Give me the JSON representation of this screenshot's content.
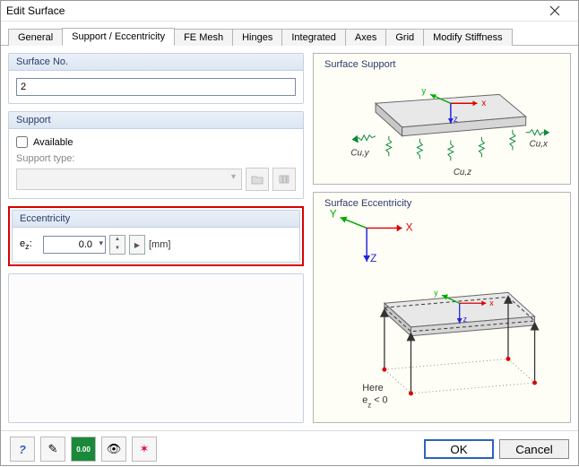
{
  "window": {
    "title": "Edit Surface"
  },
  "tabs": {
    "items": [
      {
        "label": "General"
      },
      {
        "label": "Support / Eccentricity"
      },
      {
        "label": "FE Mesh"
      },
      {
        "label": "Hinges"
      },
      {
        "label": "Integrated"
      },
      {
        "label": "Axes"
      },
      {
        "label": "Grid"
      },
      {
        "label": "Modify Stiffness"
      }
    ],
    "active_index": 1
  },
  "surface_no": {
    "title": "Surface No.",
    "value": "2"
  },
  "support": {
    "title": "Support",
    "available_label": "Available",
    "available_checked": false,
    "type_label": "Support type:"
  },
  "eccentricity": {
    "title": "Eccentricity",
    "label_html": "e",
    "sub": "z",
    "suffix": ":",
    "value": "0.0",
    "unit": "[mm]"
  },
  "preview1": {
    "title": "Surface Support",
    "axes": {
      "x": "x",
      "y": "y",
      "z": "z"
    },
    "spring_labels": {
      "x": "Cu,x",
      "y": "Cu,y",
      "z": "Cu,z"
    }
  },
  "preview2": {
    "title": "Surface Eccentricity",
    "axes_big": {
      "X": "X",
      "Y": "Y",
      "Z": "Z"
    },
    "axes": {
      "x": "x",
      "y": "y",
      "z": "z"
    },
    "note_line1": "Here",
    "note_line2_html": "e",
    "note_sub": "z",
    "note_suffix": " < 0"
  },
  "buttons": {
    "ok": "OK",
    "cancel": "Cancel"
  },
  "icons": {
    "help": "?",
    "edit": "✎",
    "units": "0.00",
    "view": "👁",
    "pick": "✶"
  }
}
